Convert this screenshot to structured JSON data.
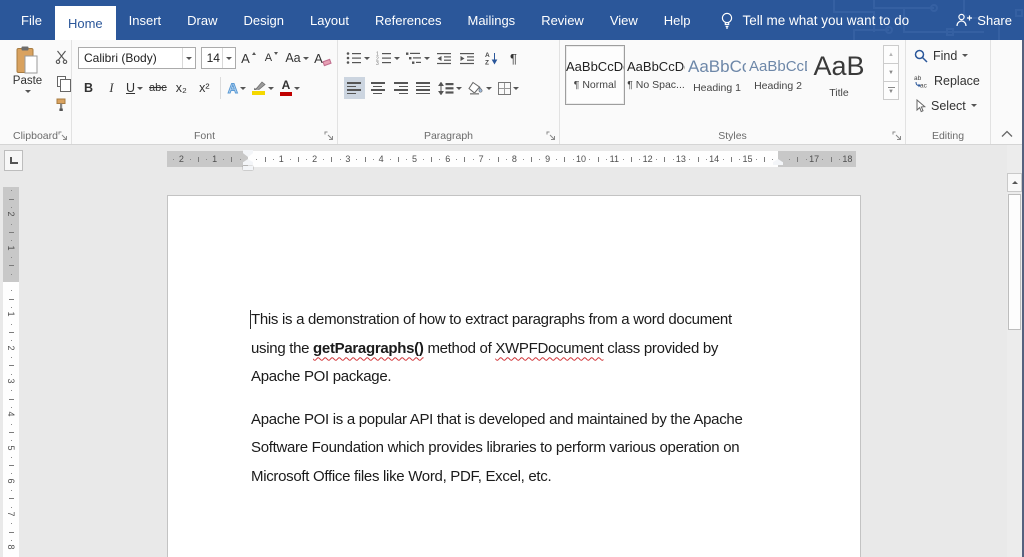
{
  "titlebar": {
    "tabs": [
      {
        "label": "File",
        "active": false
      },
      {
        "label": "Home",
        "active": true
      },
      {
        "label": "Insert",
        "active": false
      },
      {
        "label": "Draw",
        "active": false
      },
      {
        "label": "Design",
        "active": false
      },
      {
        "label": "Layout",
        "active": false
      },
      {
        "label": "References",
        "active": false
      },
      {
        "label": "Mailings",
        "active": false
      },
      {
        "label": "Review",
        "active": false
      },
      {
        "label": "View",
        "active": false
      },
      {
        "label": "Help",
        "active": false
      }
    ],
    "tell_me": "Tell me what you want to do",
    "share": "Share"
  },
  "ribbon": {
    "clipboard": {
      "label": "Clipboard",
      "paste": "Paste"
    },
    "font": {
      "label": "Font",
      "name": "Calibri (Body)",
      "size": "14",
      "bold": "B",
      "italic": "I",
      "underline": "U",
      "strikethrough": "abc",
      "subscript": "x₂",
      "superscript": "x²",
      "grow": "A",
      "shrink": "A",
      "change_case": "Aa",
      "clear": "A",
      "effects": "A",
      "color": "A"
    },
    "paragraph": {
      "label": "Paragraph",
      "pilcrow": "¶",
      "sort_a": "A",
      "sort_z": "Z"
    },
    "styles": {
      "label": "Styles",
      "items": [
        {
          "preview": "AaBbCcDd",
          "name": "¶ Normal",
          "kind": "normal",
          "selected": true
        },
        {
          "preview": "AaBbCcDd",
          "name": "¶ No Spac...",
          "kind": "normal",
          "selected": false
        },
        {
          "preview": "AaBbCc",
          "name": "Heading 1",
          "kind": "h1",
          "selected": false
        },
        {
          "preview": "AaBbCcD",
          "name": "Heading 2",
          "kind": "h2",
          "selected": false
        },
        {
          "preview": "AaB",
          "name": "Title",
          "kind": "title",
          "selected": false
        }
      ]
    },
    "editing": {
      "label": "Editing",
      "find": "Find",
      "replace": "Replace",
      "select": "Select"
    }
  },
  "ruler": {
    "h_margin_left": [
      2,
      1
    ],
    "h_main": [
      1,
      2,
      3,
      4,
      5,
      6,
      7,
      8,
      9,
      10,
      11,
      12,
      13,
      14,
      15
    ],
    "h_margin_right": [
      17,
      18
    ],
    "v_margin_top": [
      2,
      1
    ],
    "v_main": [
      1,
      2,
      3,
      4,
      5,
      6,
      7,
      8
    ]
  },
  "document": {
    "paragraphs": [
      {
        "lines": [
          [
            {
              "text": "This is a demonstration of how to extract paragraphs from a word document"
            }
          ],
          [
            {
              "text": "using the "
            },
            {
              "text": "getParagraphs()",
              "bold": true,
              "misspelled": true
            },
            {
              "text": " method of "
            },
            {
              "text": "XWPFDocument",
              "misspelled": true
            },
            {
              "text": " class provided by"
            }
          ],
          [
            {
              "text": "Apache POI package."
            }
          ]
        ]
      },
      {
        "lines": [
          [
            {
              "text": "Apache POI is a popular API that is developed and maintained by the Apache"
            }
          ],
          [
            {
              "text": "Software Foundation which provides libraries to perform various operation on"
            }
          ],
          [
            {
              "text": "Microsoft Office files like Word, PDF, Excel, etc."
            }
          ]
        ]
      }
    ]
  },
  "colors": {
    "titlebar": "#2b579a",
    "accent": "#2b579a",
    "doc_bg": "#e9e9e9",
    "ruler_margin": "#c8c8c8",
    "heading_preview": "#6d87a8",
    "spell": "#d13438",
    "font_color_bar": "#c00000",
    "highlight": "#f5d800",
    "paste_tan": "#d9a25f",
    "align_selected": "#ccd5e0"
  }
}
